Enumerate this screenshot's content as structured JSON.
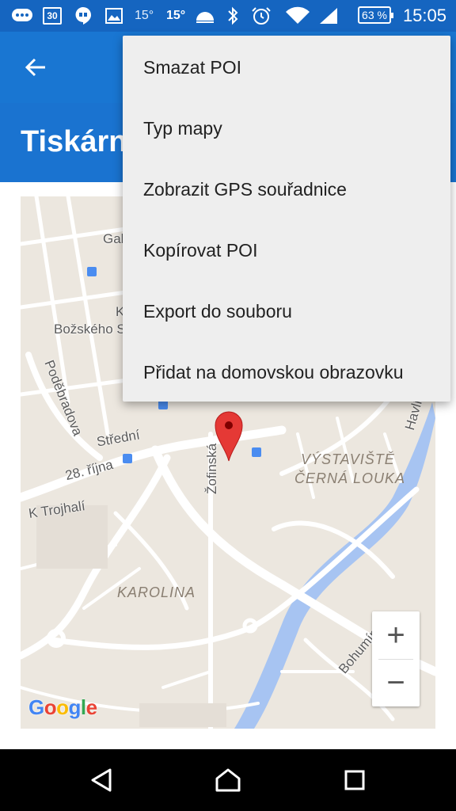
{
  "status_bar": {
    "temp1": "15°",
    "temp2": "15°",
    "calendar_day": "30",
    "battery": "63 %",
    "time": "15:05"
  },
  "header": {
    "title": "Tiskárn"
  },
  "menu": {
    "items": [
      {
        "label": "Smazat POI"
      },
      {
        "label": "Typ mapy"
      },
      {
        "label": "Zobrazit GPS souřadnice"
      },
      {
        "label": "Kopírovat POI"
      },
      {
        "label": "Export do souboru"
      },
      {
        "label": "Přidat na domovskou obrazovku"
      }
    ]
  },
  "map": {
    "labels": {
      "gal": "Gal",
      "k": "K",
      "bozskeho": "Božského S",
      "podebradova": "Poděbradova",
      "stredni": "Střední",
      "rijna": "28. října",
      "trojhali": "K Trojhalí",
      "zofinska": "Žofinská",
      "vystaviste": "VÝSTAVIŠTĚ",
      "cerna_louka": "ČERNÁ LOUKA",
      "havlic": "Havlíč",
      "karolina": "KAROLINA",
      "bohuminska": "Bohumínská"
    },
    "zoom_in": "+",
    "zoom_out": "−",
    "logo": "Google",
    "colors": {
      "land": "#ece7df",
      "road": "#ffffff",
      "river": "#a7c4f2",
      "marker": "#e53935"
    }
  },
  "colors": {
    "status_bar": "#1565c0",
    "app_bar": "#1976d2",
    "menu_bg": "#eeeeee"
  }
}
